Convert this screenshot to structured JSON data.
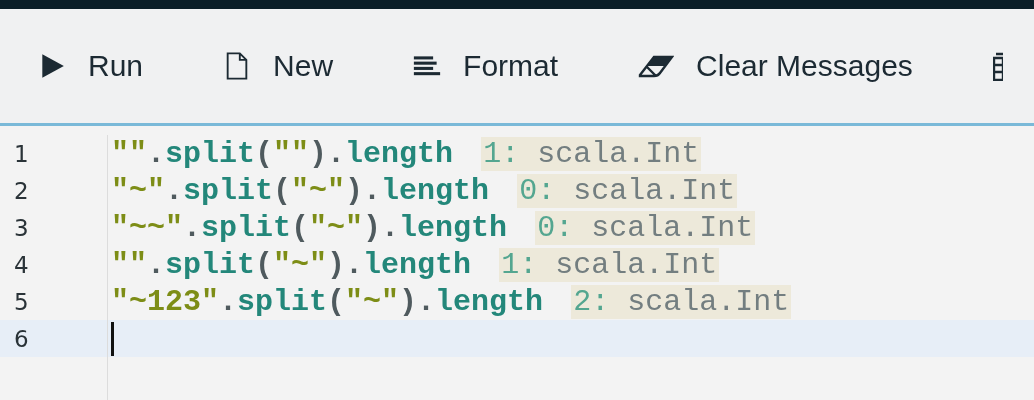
{
  "toolbar": [
    {
      "kind": "run",
      "label": "Run"
    },
    {
      "kind": "new",
      "label": "New"
    },
    {
      "kind": "format",
      "label": "Format"
    },
    {
      "kind": "clear",
      "label": "Clear Messages"
    },
    {
      "kind": "clip"
    }
  ],
  "editor": {
    "lines": [
      {
        "number": "1",
        "active": false,
        "tokens": [
          {
            "kind": "string",
            "text": "\"\""
          },
          {
            "kind": "punct",
            "text": "."
          },
          {
            "kind": "ident",
            "text": "split"
          },
          {
            "kind": "punct",
            "text": "("
          },
          {
            "kind": "string",
            "text": "\"\""
          },
          {
            "kind": "punct",
            "text": ")."
          },
          {
            "kind": "ident",
            "text": "length"
          }
        ],
        "result": {
          "value": "1:",
          "type": "scala.Int"
        }
      },
      {
        "number": "2",
        "active": false,
        "tokens": [
          {
            "kind": "string",
            "text": "\"~\""
          },
          {
            "kind": "punct",
            "text": "."
          },
          {
            "kind": "ident",
            "text": "split"
          },
          {
            "kind": "punct",
            "text": "("
          },
          {
            "kind": "string",
            "text": "\"~\""
          },
          {
            "kind": "punct",
            "text": ")."
          },
          {
            "kind": "ident",
            "text": "length"
          }
        ],
        "result": {
          "value": "0:",
          "type": "scala.Int"
        }
      },
      {
        "number": "3",
        "active": false,
        "tokens": [
          {
            "kind": "string",
            "text": "\"~~\""
          },
          {
            "kind": "punct",
            "text": "."
          },
          {
            "kind": "ident",
            "text": "split"
          },
          {
            "kind": "punct",
            "text": "("
          },
          {
            "kind": "string",
            "text": "\"~\""
          },
          {
            "kind": "punct",
            "text": ")."
          },
          {
            "kind": "ident",
            "text": "length"
          }
        ],
        "result": {
          "value": "0:",
          "type": "scala.Int"
        }
      },
      {
        "number": "4",
        "active": false,
        "tokens": [
          {
            "kind": "string",
            "text": "\"\""
          },
          {
            "kind": "punct",
            "text": "."
          },
          {
            "kind": "ident",
            "text": "split"
          },
          {
            "kind": "punct",
            "text": "("
          },
          {
            "kind": "string",
            "text": "\"~\""
          },
          {
            "kind": "punct",
            "text": ")."
          },
          {
            "kind": "ident",
            "text": "length"
          }
        ],
        "result": {
          "value": "1:",
          "type": "scala.Int"
        }
      },
      {
        "number": "5",
        "active": false,
        "tokens": [
          {
            "kind": "string",
            "text": "\"~123\""
          },
          {
            "kind": "punct",
            "text": "."
          },
          {
            "kind": "ident",
            "text": "split"
          },
          {
            "kind": "punct",
            "text": "("
          },
          {
            "kind": "string",
            "text": "\"~\""
          },
          {
            "kind": "punct",
            "text": ")."
          },
          {
            "kind": "ident",
            "text": "length"
          }
        ],
        "result": {
          "value": "2:",
          "type": "scala.Int"
        }
      },
      {
        "number": "6",
        "active": true
      }
    ]
  }
}
